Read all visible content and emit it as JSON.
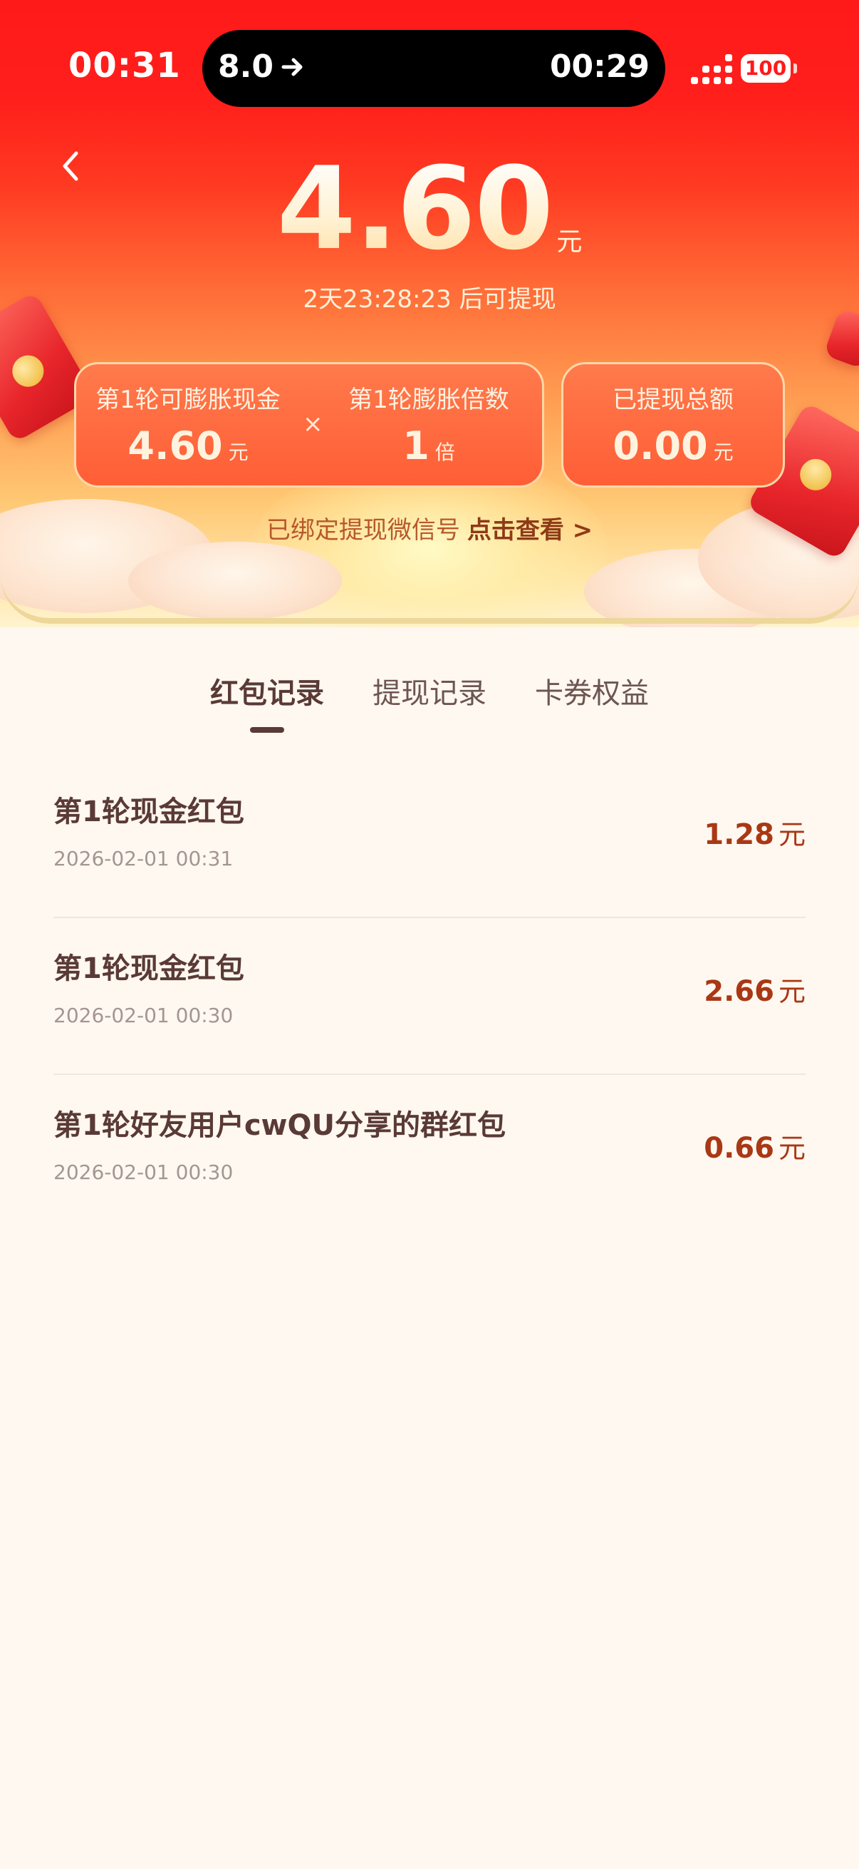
{
  "status_bar": {
    "time": "00:31",
    "island_left": "8.0",
    "island_right": "00:29",
    "battery": "100"
  },
  "balance": {
    "amount": "4.60",
    "unit": "元",
    "countdown": "2天23:28:23 后可提现"
  },
  "stats": {
    "inflatable_cash_label": "第1轮可膨胀现金",
    "inflatable_cash_value": "4.60",
    "inflatable_cash_unit": "元",
    "operator": "×",
    "multiplier_label": "第1轮膨胀倍数",
    "multiplier_value": "1",
    "multiplier_unit": "倍",
    "withdrawn_label": "已提现总额",
    "withdrawn_value": "0.00",
    "withdrawn_unit": "元"
  },
  "wechat": {
    "text": "已绑定提现微信号",
    "link": "点击查看 >"
  },
  "tabs": [
    {
      "label": "红包记录",
      "active": true
    },
    {
      "label": "提现记录",
      "active": false
    },
    {
      "label": "卡券权益",
      "active": false
    }
  ],
  "records": [
    {
      "title": "第1轮现金红包",
      "time": "2026-02-01 00:31",
      "amount": "1.28",
      "unit": "元"
    },
    {
      "title": "第1轮现金红包",
      "time": "2026-02-01 00:30",
      "amount": "2.66",
      "unit": "元"
    },
    {
      "title": "第1轮好友用户cwQU分享的群红包",
      "time": "2026-02-01 00:30",
      "amount": "0.66",
      "unit": "元"
    }
  ],
  "colors": {
    "header_red": "#FF1A1A",
    "amount_brown": "#A93815",
    "text_dark": "#5a3a36",
    "page_bg": "#FFF8F0"
  },
  "icons": {
    "back": "chevron-left-icon",
    "arrow": "navigation-arrow-icon",
    "signal": "cellular-signal-icon",
    "battery": "battery-icon"
  }
}
